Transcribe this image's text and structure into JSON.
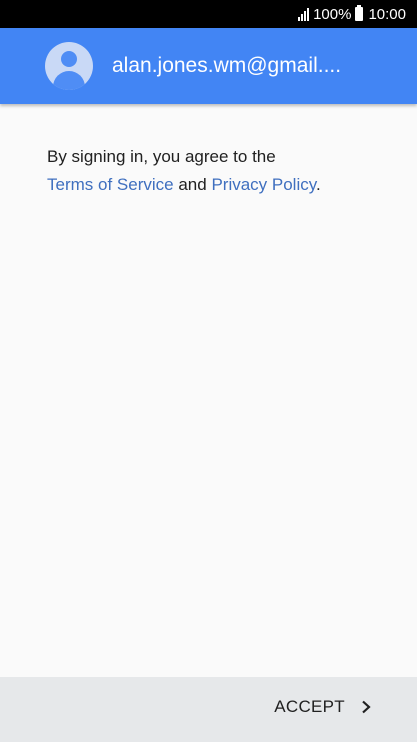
{
  "status_bar": {
    "battery": "100%",
    "time": "10:00"
  },
  "header": {
    "account_email": "alan.jones.wm@gmail...."
  },
  "content": {
    "intro": "By signing in, you agree to the",
    "terms_link": "Terms of Service",
    "conjunction": "and",
    "privacy_link": "Privacy Policy",
    "period": "."
  },
  "footer": {
    "accept_label": "ACCEPT"
  },
  "colors": {
    "header_bg": "#4285f4",
    "link": "#3f6fbf",
    "footer_bg": "#e6e8ea"
  },
  "icons": [
    "signal-icon",
    "battery-icon",
    "avatar-icon",
    "chevron-right-icon"
  ]
}
